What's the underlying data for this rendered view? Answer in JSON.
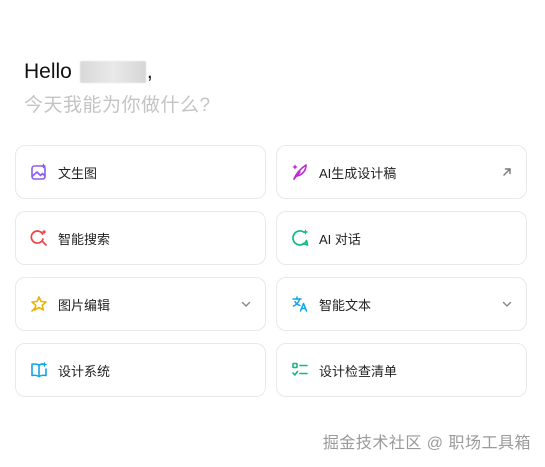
{
  "greeting": {
    "hello": "Hello",
    "comma": ",",
    "subtitle": "今天我能为你做什么?"
  },
  "cards": [
    {
      "label": "文生图",
      "icon": "image-sparkle-icon",
      "color": "#8b5cf6"
    },
    {
      "label": "AI生成设计稿",
      "icon": "feather-pen-icon",
      "color": "#c026d3",
      "trail": "arrow-up-right-icon"
    },
    {
      "label": "智能搜索",
      "icon": "search-sparkle-icon",
      "color": "#ef4444"
    },
    {
      "label": "AI 对话",
      "icon": "chat-bubble-icon",
      "color": "#10b981"
    },
    {
      "label": "图片编辑",
      "icon": "star-edit-icon",
      "color": "#eab308",
      "trail": "chevron-down-icon"
    },
    {
      "label": "智能文本",
      "icon": "translate-icon",
      "color": "#0ea5e9",
      "trail": "chevron-down-icon"
    },
    {
      "label": "设计系统",
      "icon": "book-open-icon",
      "color": "#0ea5e9"
    },
    {
      "label": "设计检查清单",
      "icon": "checklist-icon",
      "color": "#10b981"
    }
  ],
  "watermark": "掘金技术社区 @ 职场工具箱"
}
